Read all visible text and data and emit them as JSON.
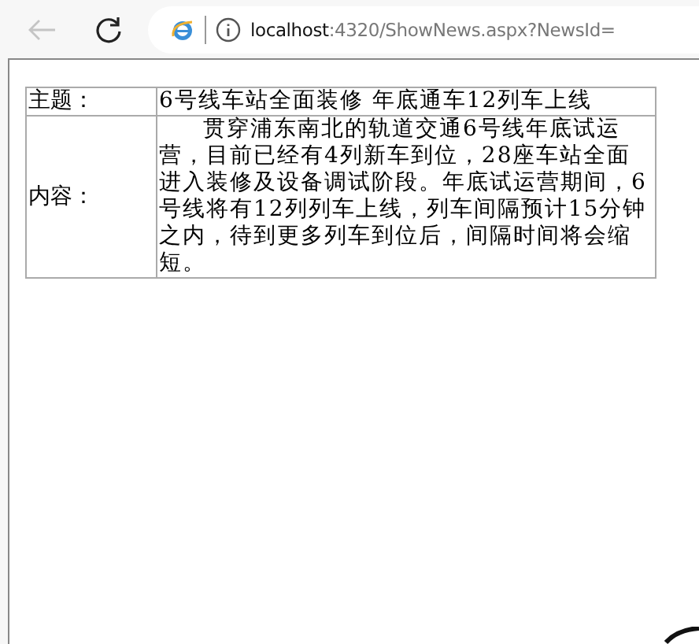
{
  "browser": {
    "back_disabled": true,
    "url_host": "localhost",
    "url_rest": ":4320/ShowNews.aspx?NewsId="
  },
  "rows": [
    {
      "label": "主题：",
      "value": "6号线车站全面装修 年底通车12列车上线",
      "indent": false
    },
    {
      "label": "内容：",
      "value": "贯穿浦东南北的轨道交通6号线年底试运营，目前已经有4列新车到位，28座车站全面进入装修及设备调试阶段。年底试运营期间，6号线将有12列列车上线，列车间隔预计15分钟之内，待到更多列车到位后，间隔时间将会缩短。",
      "indent": true
    }
  ]
}
